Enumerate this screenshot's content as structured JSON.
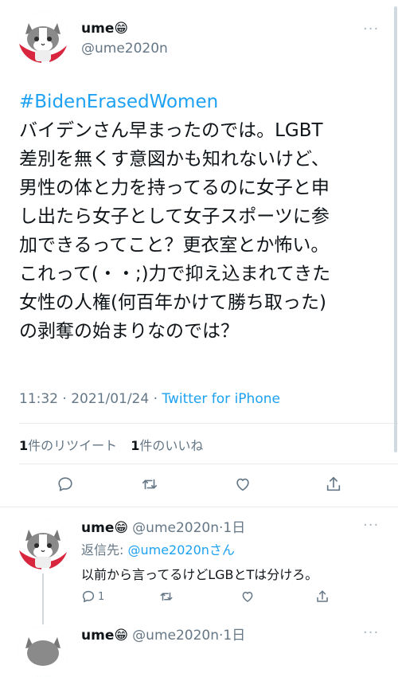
{
  "main_tweet": {
    "display_name": "ume😁",
    "handle": "@ume2020n",
    "more_label": "···",
    "hashtag": "#BidenErasedWomen",
    "body_lines": [
      "バイデンさん早まったのでは。LGBT",
      "差別を無くす意図かも知れないけど、",
      "男性の体と力を持ってるのに女子と申",
      "し出たら女子として女子スポーツに参",
      "加できるってこと？更衣室とか怖い。",
      "これって(・・;)力で抑え込まれてきた",
      "女性の人権(何百年かけて勝ち取った)",
      "の剥奪の始まりなのでは？"
    ],
    "timestamp": "11:32 · 2021/01/24 · ",
    "source": "Twitter for iPhone",
    "retweet_count": "1",
    "retweet_label": "件のリツイート",
    "like_count": "1",
    "like_label": "件のいいね"
  },
  "replies": [
    {
      "display_name": "ume😁",
      "handle_time": "@ume2020n·1日",
      "more_label": "···",
      "reply_to_prefix": "返信先: ",
      "reply_to_handle": "@ume2020nさん",
      "body": "以前から言ってるけどLGBとTは分けろ。",
      "reply_count": "1"
    },
    {
      "display_name": "ume😁",
      "handle_time": "@ume2020n·1日",
      "more_label": "···"
    }
  ],
  "colors": {
    "accent": "#1da1f2",
    "muted": "#657786",
    "divider": "#e6ecf0",
    "avatar_red": "#e0245e"
  },
  "icons": [
    "cat-avatar",
    "reply-icon",
    "retweet-icon",
    "like-icon",
    "share-icon",
    "more-icon"
  ]
}
